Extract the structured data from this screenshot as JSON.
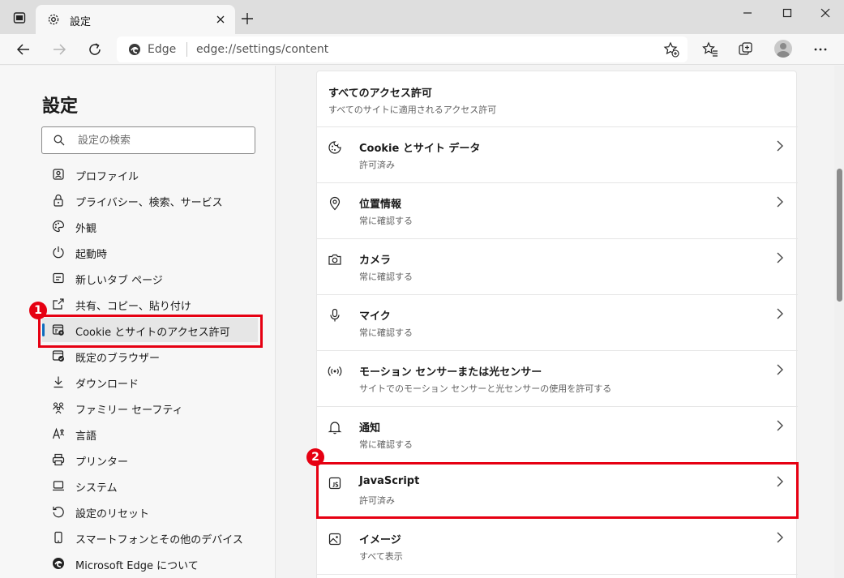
{
  "tab": {
    "title": "設定"
  },
  "address": {
    "brand": "Edge",
    "url": "edge://settings/content"
  },
  "sidebar": {
    "title": "設定",
    "search_placeholder": "設定の検索",
    "items": [
      {
        "label": "プロファイル",
        "icon": "profile-icon"
      },
      {
        "label": "プライバシー、検索、サービス",
        "icon": "lock-icon"
      },
      {
        "label": "外観",
        "icon": "palette-icon"
      },
      {
        "label": "起動時",
        "icon": "power-icon"
      },
      {
        "label": "新しいタブ ページ",
        "icon": "new-tab-page-icon"
      },
      {
        "label": "共有、コピー、貼り付け",
        "icon": "share-icon"
      },
      {
        "label": "Cookie とサイトのアクセス許可",
        "icon": "site-permissions-icon",
        "active": true
      },
      {
        "label": "既定のブラウザー",
        "icon": "default-browser-icon"
      },
      {
        "label": "ダウンロード",
        "icon": "download-icon"
      },
      {
        "label": "ファミリー セーフティ",
        "icon": "family-icon"
      },
      {
        "label": "言語",
        "icon": "language-icon"
      },
      {
        "label": "プリンター",
        "icon": "printer-icon"
      },
      {
        "label": "システム",
        "icon": "laptop-icon"
      },
      {
        "label": "設定のリセット",
        "icon": "reset-icon"
      },
      {
        "label": "スマートフォンとその他のデバイス",
        "icon": "phone-icon"
      },
      {
        "label": "Microsoft Edge について",
        "icon": "edge-logo-icon"
      }
    ]
  },
  "main": {
    "section_title": "すべてのアクセス許可",
    "section_subtitle": "すべてのサイトに適用されるアクセス許可",
    "permissions": [
      {
        "title": "Cookie とサイト データ",
        "subtitle": "許可済み",
        "icon": "cookie-icon"
      },
      {
        "title": "位置情報",
        "subtitle": "常に確認する",
        "icon": "location-icon"
      },
      {
        "title": "カメラ",
        "subtitle": "常に確認する",
        "icon": "camera-icon"
      },
      {
        "title": "マイク",
        "subtitle": "常に確認する",
        "icon": "microphone-icon"
      },
      {
        "title": "モーション センサーまたは光センサー",
        "subtitle": "サイトでのモーション センサーと光センサーの使用を許可する",
        "icon": "sensor-icon"
      },
      {
        "title": "通知",
        "subtitle": "常に確認する",
        "icon": "bell-icon"
      },
      {
        "title": "JavaScript",
        "subtitle": "許可済み",
        "icon": "javascript-icon"
      },
      {
        "title": "イメージ",
        "subtitle": "すべて表示",
        "icon": "image-icon"
      }
    ]
  },
  "annotations": [
    {
      "number": "1",
      "color": "#e60012"
    },
    {
      "number": "2",
      "color": "#e60012"
    }
  ],
  "colors": {
    "accent": "#0f6cbd",
    "highlight": "#e60012"
  }
}
